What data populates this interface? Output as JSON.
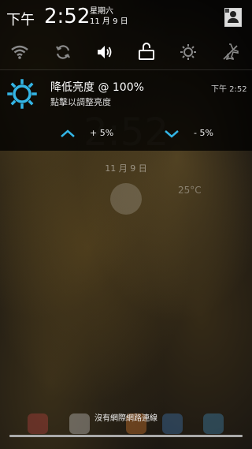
{
  "statusbar": {
    "time_prefix": "下午",
    "time": "2:52",
    "weekday": "星期六",
    "date": "11 月 9 日"
  },
  "quick_settings": {
    "items": [
      "wifi-icon",
      "sync-icon",
      "sound-icon",
      "rotation-icon",
      "brightness-icon",
      "airplane-off-icon"
    ],
    "active_color": "#ffffff",
    "inactive_color": "#8a8a8a"
  },
  "notification": {
    "title": "降低亮度 @ 100%",
    "subtitle": "點擊以調整亮度",
    "time": "下午 2:52",
    "increase_label": "+ 5%",
    "decrease_label": "- 5%",
    "accent": "#33b5e5"
  },
  "lockscreen_background": {
    "clock": "2:52",
    "date": "11 月 9 日",
    "temperature": "25°C"
  },
  "footer": {
    "network_status": "沒有網際網路連線"
  }
}
